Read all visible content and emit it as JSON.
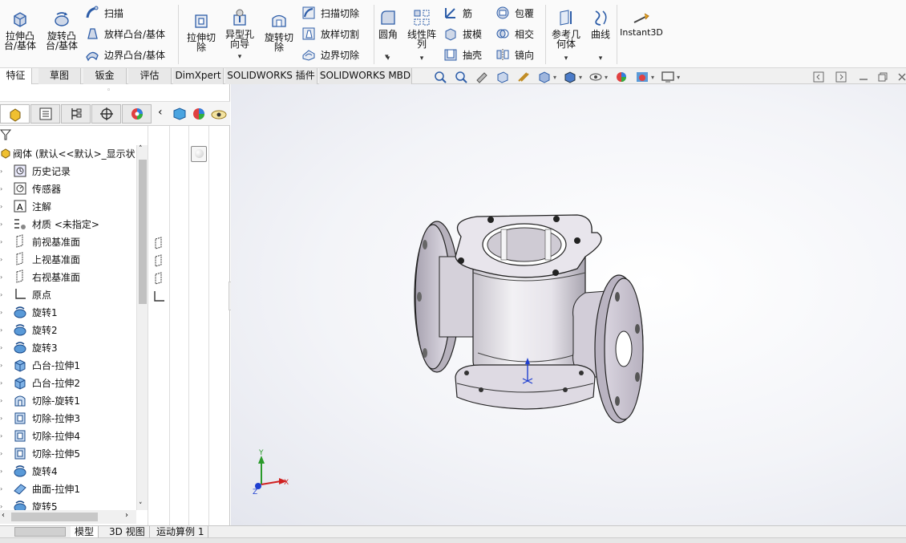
{
  "ribbon": {
    "extrude_boss": "拉伸凸\n台/基体",
    "revolve_boss": "旋转凸\n台/基体",
    "sweep": "扫描",
    "loft_boss": "放样凸台/基体",
    "boundary_boss": "边界凸台/基体",
    "extrude_cut": "拉伸切\n除",
    "hole_wizard": "异型孔\n向导",
    "revolve_cut": "旋转切\n除",
    "sweep_cut": "扫描切除",
    "loft_cut": "放样切割",
    "boundary_cut": "边界切除",
    "fillet": "圆角",
    "linear_pattern": "线性阵\n列",
    "rib": "筋",
    "draft": "拔模",
    "shell": "抽壳",
    "wrap": "包覆",
    "intersect": "相交",
    "mirror": "镜向",
    "ref_geometry": "参考几\n何体",
    "curves": "曲线",
    "instant3d": "Instant3D"
  },
  "tabs": [
    "特征",
    "草图",
    "钣金",
    "评估",
    "DimXpert",
    "SOLIDWORKS 插件",
    "SOLIDWORKS MBD"
  ],
  "active_tab": "特征",
  "tree": {
    "root": "阀体 (默认<<默认>_显示状",
    "items": [
      {
        "label": "历史记录",
        "icon": "history-icon"
      },
      {
        "label": "传感器",
        "icon": "sensor-icon"
      },
      {
        "label": "注解",
        "icon": "annotation-icon"
      },
      {
        "label": "材质 <未指定>",
        "icon": "material-icon"
      },
      {
        "label": "前视基准面",
        "icon": "plane-icon"
      },
      {
        "label": "上视基准面",
        "icon": "plane-icon"
      },
      {
        "label": "右视基准面",
        "icon": "plane-icon"
      },
      {
        "label": "原点",
        "icon": "origin-icon"
      },
      {
        "label": "旋转1",
        "icon": "revolve-icon"
      },
      {
        "label": "旋转2",
        "icon": "revolve-icon"
      },
      {
        "label": "旋转3",
        "icon": "revolve-icon"
      },
      {
        "label": "凸台-拉伸1",
        "icon": "extrude-icon"
      },
      {
        "label": "凸台-拉伸2",
        "icon": "extrude-icon"
      },
      {
        "label": "切除-旋转1",
        "icon": "revolve-cut-icon"
      },
      {
        "label": "切除-拉伸3",
        "icon": "extrude-cut-icon"
      },
      {
        "label": "切除-拉伸4",
        "icon": "extrude-cut-icon"
      },
      {
        "label": "切除-拉伸5",
        "icon": "extrude-cut-icon"
      },
      {
        "label": "旋转4",
        "icon": "revolve-icon"
      },
      {
        "label": "曲面-拉伸1",
        "icon": "surface-extrude-icon"
      },
      {
        "label": "旋转5",
        "icon": "revolve-icon"
      }
    ]
  },
  "bottom_tabs": [
    "模型",
    "3D 视图",
    "运动算例 1"
  ],
  "active_bottom_tab": "模型",
  "triad": {
    "x": "X",
    "y": "Y",
    "z": "Z"
  },
  "colors": {
    "accent": "#1f5fbf",
    "plane": "#3a6fc4",
    "model_face": "#dcd8e0"
  }
}
